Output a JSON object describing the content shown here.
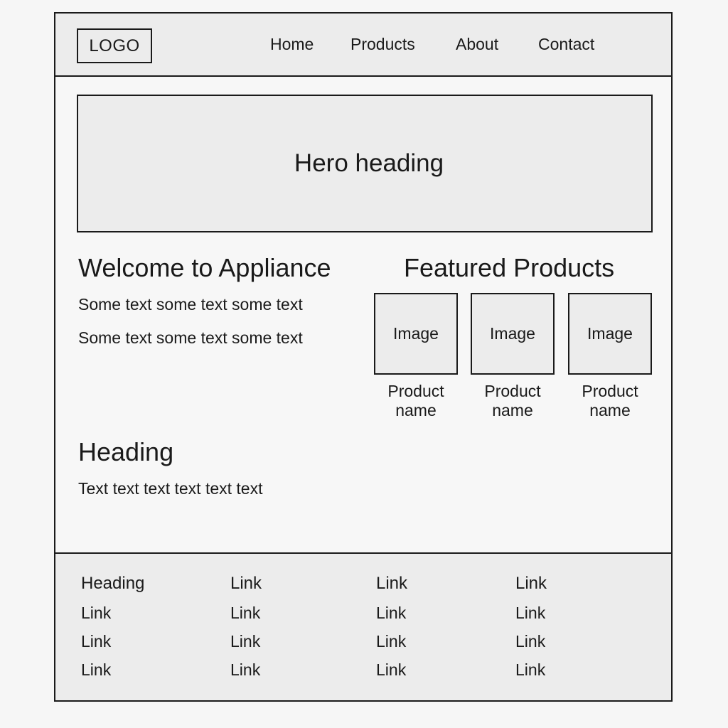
{
  "header": {
    "logo": "LOGO",
    "nav": [
      "Home",
      "Products",
      "About",
      "Contact"
    ]
  },
  "hero": {
    "heading": "Hero heading"
  },
  "welcome": {
    "title": "Welcome to Appliance",
    "lines": [
      "Some text some text some text",
      "Some text some text some text"
    ]
  },
  "featured": {
    "title": "Featured Products",
    "products": [
      {
        "image_label": "Image",
        "name": "Product name"
      },
      {
        "image_label": "Image",
        "name": "Product name"
      },
      {
        "image_label": "Image",
        "name": "Product name"
      }
    ]
  },
  "section": {
    "heading": "Heading",
    "text": "Text text text text text text"
  },
  "footer": {
    "columns": [
      {
        "heading": "Heading",
        "links": [
          "Link",
          "Link",
          "Link"
        ]
      },
      {
        "heading": "Link",
        "links": [
          "Link",
          "Link",
          "Link"
        ]
      },
      {
        "heading": "Link",
        "links": [
          "Link",
          "Link",
          "Link"
        ]
      },
      {
        "heading": "Link",
        "links": [
          "Link",
          "Link",
          "Link"
        ]
      }
    ]
  },
  "colors": {
    "background": "#f6f6f6",
    "panel": "#ececec",
    "stroke": "#1a1a1a"
  }
}
